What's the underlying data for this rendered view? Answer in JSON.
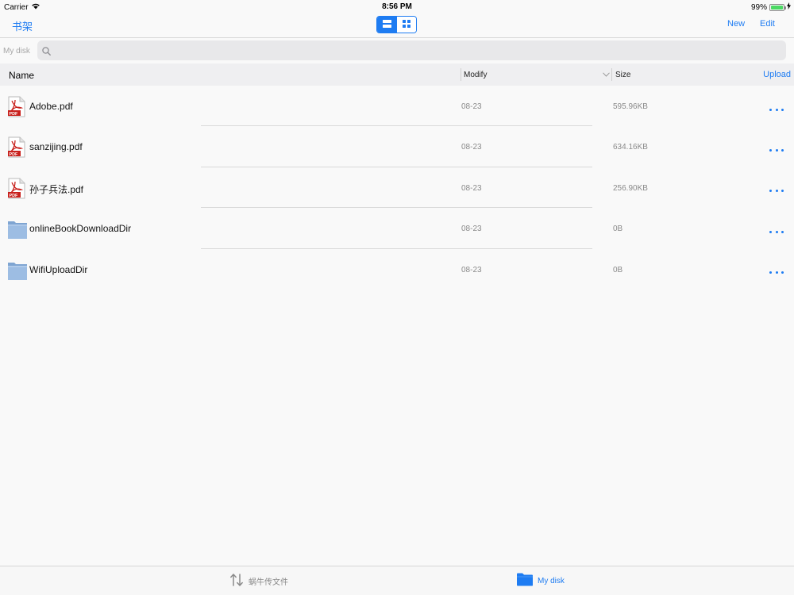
{
  "status_bar": {
    "carrier": "Carrier",
    "time": "8:56 PM",
    "battery": "99%",
    "battery_level": 0.99
  },
  "nav": {
    "back_label": "书架",
    "view_modes": [
      "list-view-icon",
      "grid-view-icon"
    ],
    "active_view": "list",
    "new_label": "New",
    "edit_label": "Edit"
  },
  "search": {
    "path_label": "My disk",
    "placeholder": ""
  },
  "table_header": {
    "name": "Name",
    "modify": "Modify",
    "size": "Size",
    "upload": "Upload"
  },
  "files": [
    {
      "name": "Adobe.pdf",
      "date": "08-23",
      "size": "595.96KB",
      "type": "pdf"
    },
    {
      "name": "sanzijing.pdf",
      "date": "08-23",
      "size": "634.16KB",
      "type": "pdf"
    },
    {
      "name": "孙子兵法.pdf",
      "date": "08-23",
      "size": "256.90KB",
      "type": "pdf"
    },
    {
      "name": "onlineBookDownloadDir",
      "date": "08-23",
      "size": "0B",
      "type": "folder"
    },
    {
      "name": "WifiUploadDir",
      "date": "08-23",
      "size": "0B",
      "type": "folder"
    }
  ],
  "tab_bar": {
    "transfer_label": "蜗牛传文件",
    "disk_label": "My disk",
    "active": "disk"
  },
  "colors": {
    "accent": "#1e7cf2",
    "pdf_red": "#c8201c",
    "folder_blue": "#8aaed6"
  }
}
